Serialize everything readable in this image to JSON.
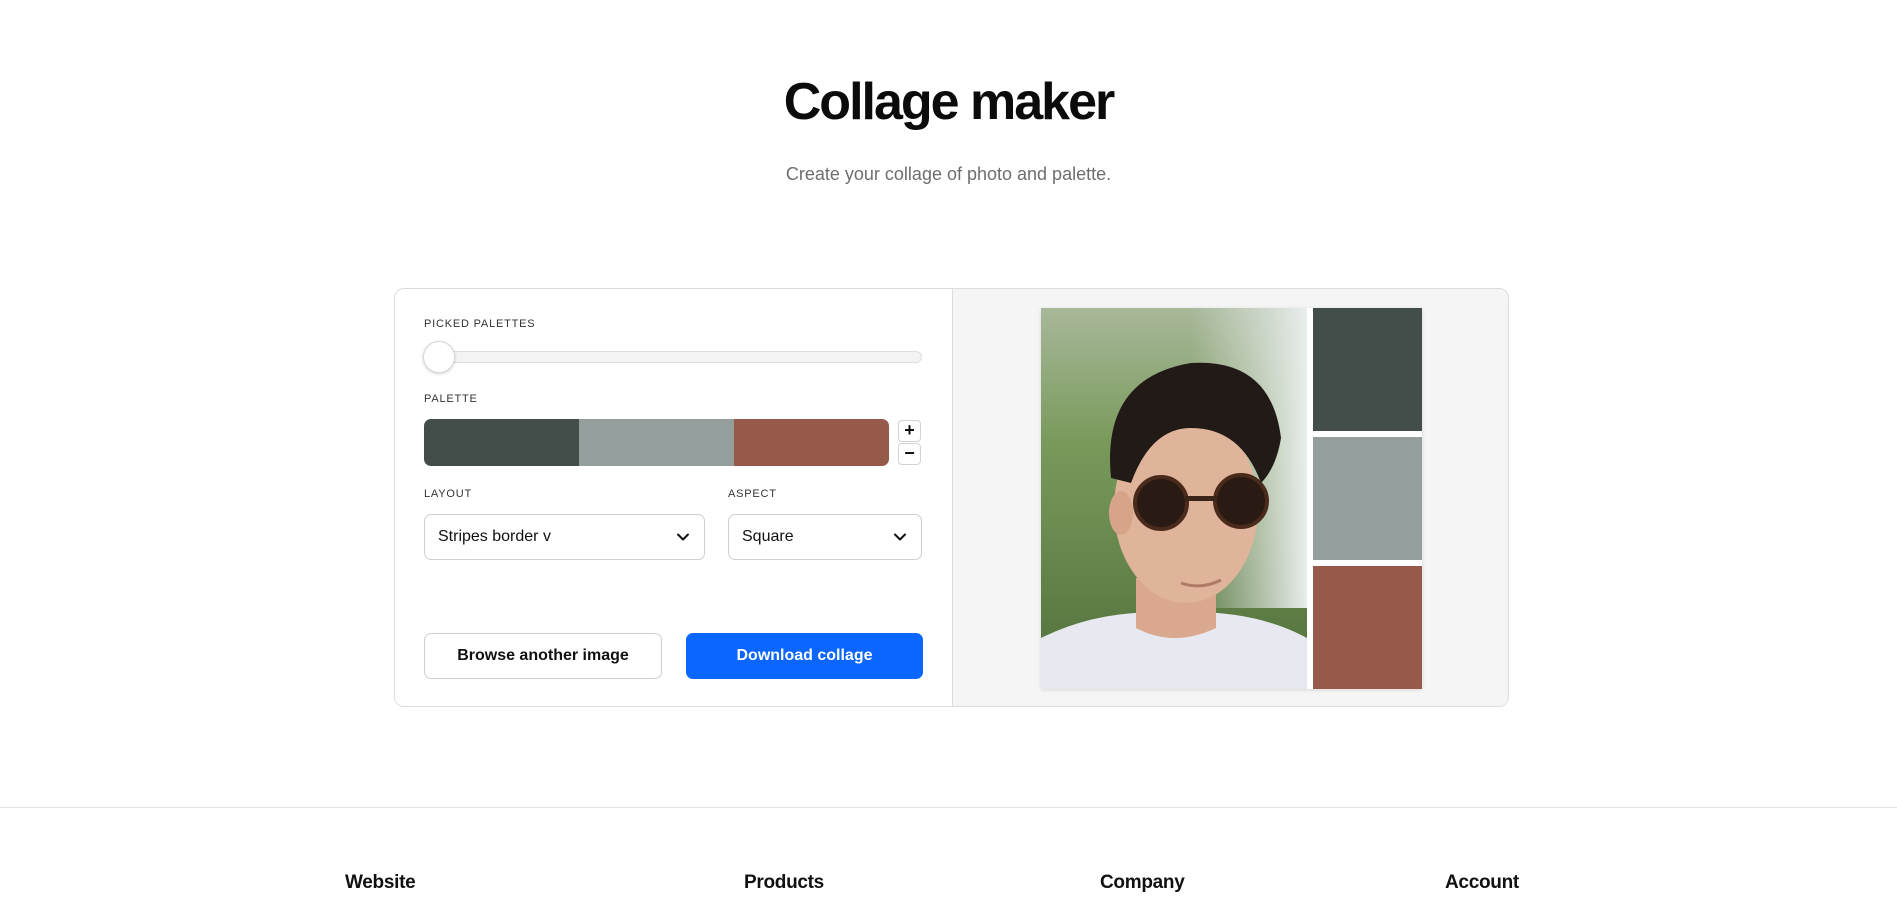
{
  "header": {
    "title": "Collage maker",
    "subtitle": "Create your collage of photo and palette."
  },
  "controls": {
    "picked_palettes_label": "PICKED PALETTES",
    "picked_palettes_slider_value": 0,
    "palette_label": "PALETTE",
    "palette_colors": [
      "#434e4a",
      "#949e9d",
      "#965a4b"
    ],
    "add_color_label": "+",
    "remove_color_label": "−",
    "layout_label": "LAYOUT",
    "layout_value": "Stripes border v",
    "aspect_label": "ASPECT",
    "aspect_value": "Square",
    "browse_button_label": "Browse another image",
    "download_button_label": "Download collage"
  },
  "preview": {
    "stripe_colors": [
      "#434e4a",
      "#949e9d",
      "#965a4b"
    ]
  },
  "colors": {
    "primary_button": "#0a66ff",
    "preview_background": "#f5f5f5"
  },
  "footer": {
    "columns": [
      "Website",
      "Products",
      "Company",
      "Account"
    ]
  }
}
